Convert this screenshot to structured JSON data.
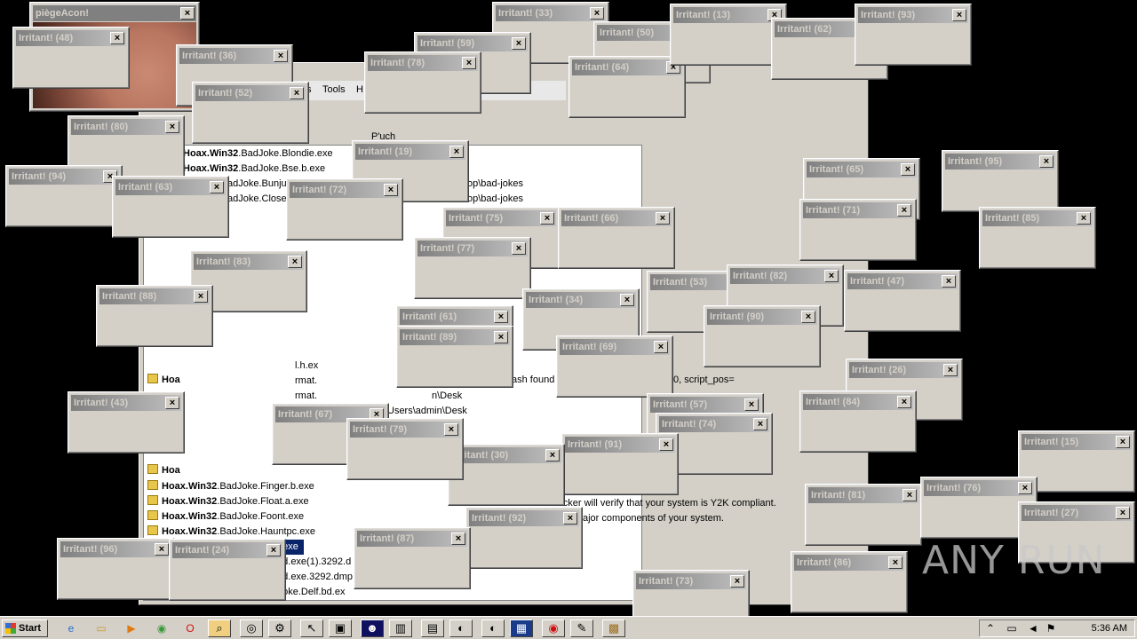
{
  "background_window": {
    "menu_tools": "Tools",
    "menu_help": "H",
    "menu_partial": "s",
    "path_fragments": [
      "op\\bad-jokes",
      "op\\bad-jokes",
      "ash found",
      "0, script_pos=",
      "n\\Desk",
      "Users\\admin\\Desk",
      "checker will verify that your system is Y2K compliant.",
      "ajor components of your system.",
      "P'uch"
    ],
    "files": [
      {
        "bold": "Hoax.Win32",
        "rest": ".BadJoke.Blondie.exe"
      },
      {
        "bold": "Hoax.Win32",
        "rest": ".BadJoke.Bse.b.exe"
      },
      {
        "bold": "",
        "rest": "adJoke.Bunju"
      },
      {
        "bold": "",
        "rest": "adJoke.Close"
      },
      {
        "bold": "Hoax.Win32",
        "rest": ".BadJoke.Finger.b.exe"
      },
      {
        "bold": "Hoax.Win32",
        "rest": ".BadJoke.Float.a.exe"
      },
      {
        "bold": "Hoax.Win32",
        "rest": ".BadJoke.Foont.exe"
      },
      {
        "bold": "Hoax.Win32",
        "rest": ".BadJoke.Hauntpc.exe"
      },
      {
        "bold": "",
        "rest": "Joke.Idiot.exe"
      },
      {
        "bold": "",
        "rest": "Joke.VB.ad.exe(1).3292.d"
      },
      {
        "bold": "",
        "rest": "Joke.VB.ad.exe.3292.dmp"
      },
      {
        "bold": "in32",
        "rest": ".BadJoke.Delf.bd.ex"
      }
    ],
    "side_labels": [
      "Hoa",
      "Hoa",
      "Hoa",
      "Hoa",
      "l.h.ex",
      "rmat.",
      "rmat."
    ]
  },
  "popups": {
    "title_prefix": "Irritant!",
    "close_glyph": "×",
    "first_title": "piègeAcon!",
    "titles": [
      "Irritant! (48)",
      "Irritant! (36)",
      "Irritant! (52)",
      "Irritant! (80)",
      "Irritant! (94)",
      "Irritant! (63)",
      "Irritant! (33)",
      "Irritant! (59)",
      "Irritant! (78)",
      "Irritant! (50)",
      "Irritant! (64)",
      "Irritant! (13)",
      "Irritant! (62)",
      "Irritant! (93)",
      "Irritant! (19)",
      "Irritant! (72)",
      "Irritant! (75)",
      "Irritant! (66)",
      "Irritant! (77)",
      "Irritant! (83)",
      "Irritant! (88)",
      "Irritant! (61)",
      "Irritant! (89)",
      "Irritant! (34)",
      "Irritant! (69)",
      "Irritant! (53)",
      "Irritant! (82)",
      "Irritant! (90)",
      "Irritant! (47)",
      "Irritant! (65)",
      "Irritant! (71)",
      "Irritant! (95)",
      "Irritant! (85)",
      "Irritant! (26)",
      "Irritant! (84)",
      "Irritant! (57)",
      "Irritant! (74)",
      "Irritant! (91)",
      "Irritant! (30)",
      "Irritant! (43)",
      "Irritant! (67)",
      "Irritant! (79)",
      "Irritant! (15)",
      "Irritant! (81)",
      "Irritant! (76)",
      "Irritant! (27)",
      "Irritant! (92)",
      "Irritant! (87)",
      "Irritant! (96)",
      "Irritant! (24)",
      "Irritant! (73)",
      "Irritant! (86)"
    ]
  },
  "taskbar": {
    "start_label": "Start",
    "clock": "5:36 AM",
    "quick_icons": [
      "ie-icon",
      "folder-icon",
      "media-icon",
      "chrome-icon",
      "opera-icon"
    ],
    "tasks": [
      "search-icon",
      "eye-icon",
      "gear-icon",
      "cursor-icon",
      "window-icon",
      "skull-icon",
      "trash-icon",
      "document-icon",
      "moon-icon",
      "moon-icon",
      "chart-icon",
      "stop-icon",
      "note-icon",
      "gift-icon"
    ],
    "tray_icons": [
      "arrow-up-icon",
      "network-icon",
      "speaker-icon",
      "flag-icon"
    ]
  },
  "watermark": "ANY RUN"
}
